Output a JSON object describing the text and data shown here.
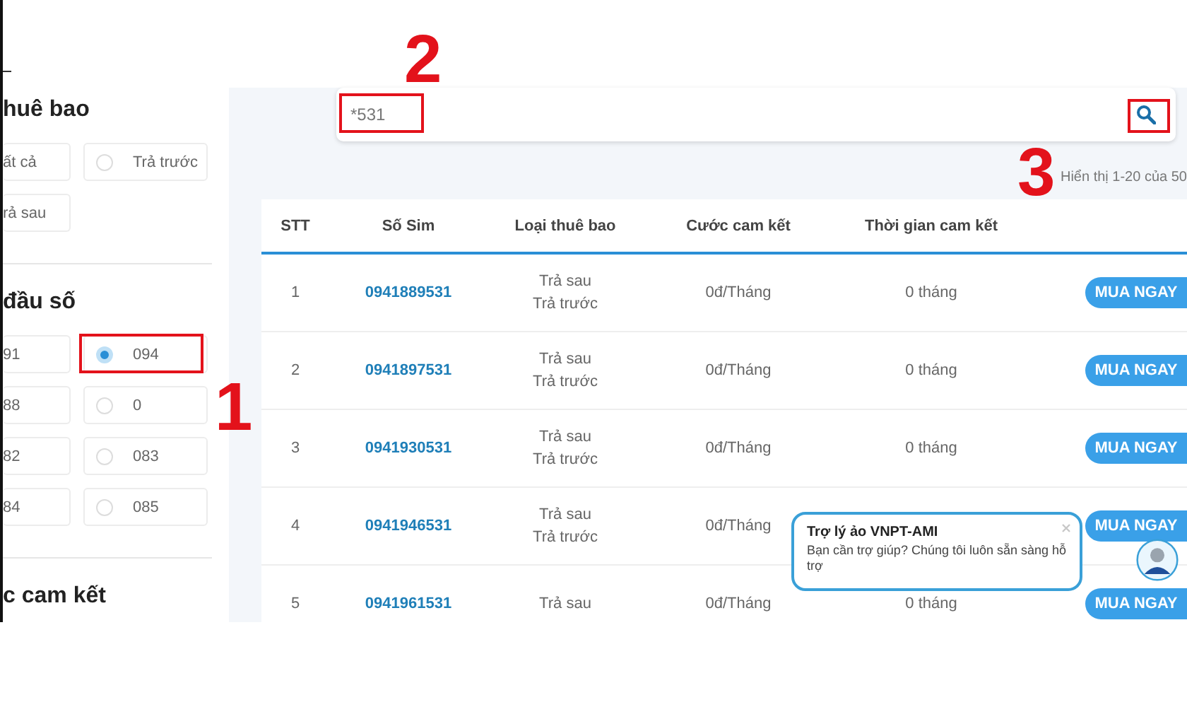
{
  "sidebar": {
    "sections": [
      {
        "heading": "huê bao",
        "options": [
          {
            "label": "ất cả"
          },
          {
            "label": "Trả trước",
            "selected": false
          },
          {
            "label": "rả sau"
          }
        ]
      },
      {
        "heading": "đầu số",
        "options": [
          {
            "label": "91"
          },
          {
            "label": "094",
            "selected": true
          },
          {
            "label": "88"
          },
          {
            "label": "0",
            "selected": false
          },
          {
            "label": "82"
          },
          {
            "label": "083",
            "selected": false
          },
          {
            "label": "84"
          },
          {
            "label": "085",
            "selected": false
          }
        ]
      },
      {
        "heading": "c cam kết"
      }
    ]
  },
  "search": {
    "value": "*531"
  },
  "result_count": "Hiển thị 1-20 của 50",
  "table": {
    "columns": [
      "STT",
      "Số Sim",
      "Loại thuê bao",
      "Cước cam kết",
      "Thời gian cam kết"
    ],
    "rows": [
      {
        "stt": "1",
        "sim": "0941889531",
        "types": [
          "Trả sau",
          "Trả trước"
        ],
        "fee": "0đ/Tháng",
        "term": "0 tháng",
        "button": "MUA NGAY"
      },
      {
        "stt": "2",
        "sim": "0941897531",
        "types": [
          "Trả sau",
          "Trả trước"
        ],
        "fee": "0đ/Tháng",
        "term": "0 tháng",
        "button": "MUA NGAY"
      },
      {
        "stt": "3",
        "sim": "0941930531",
        "types": [
          "Trả sau",
          "Trả trước"
        ],
        "fee": "0đ/Tháng",
        "term": "0 tháng",
        "button": "MUA NGAY"
      },
      {
        "stt": "4",
        "sim": "0941946531",
        "types": [
          "Trả sau",
          "Trả trước"
        ],
        "fee": "0đ/Tháng",
        "term": "",
        "button": "MUA NGAY"
      },
      {
        "stt": "5",
        "sim": "0941961531",
        "types": [
          "Trả sau"
        ],
        "fee": "0đ/Tháng",
        "term": "0 tháng",
        "button": "MUA NGAY"
      }
    ]
  },
  "chat_popup": {
    "title": "Trợ lý ảo VNPT-AMI",
    "message": "Bạn cần trợ giúp? Chúng tôi luôn sẵn sàng hỗ trợ"
  },
  "annotations": [
    {
      "label": "1"
    },
    {
      "label": "2"
    },
    {
      "label": "3"
    }
  ]
}
